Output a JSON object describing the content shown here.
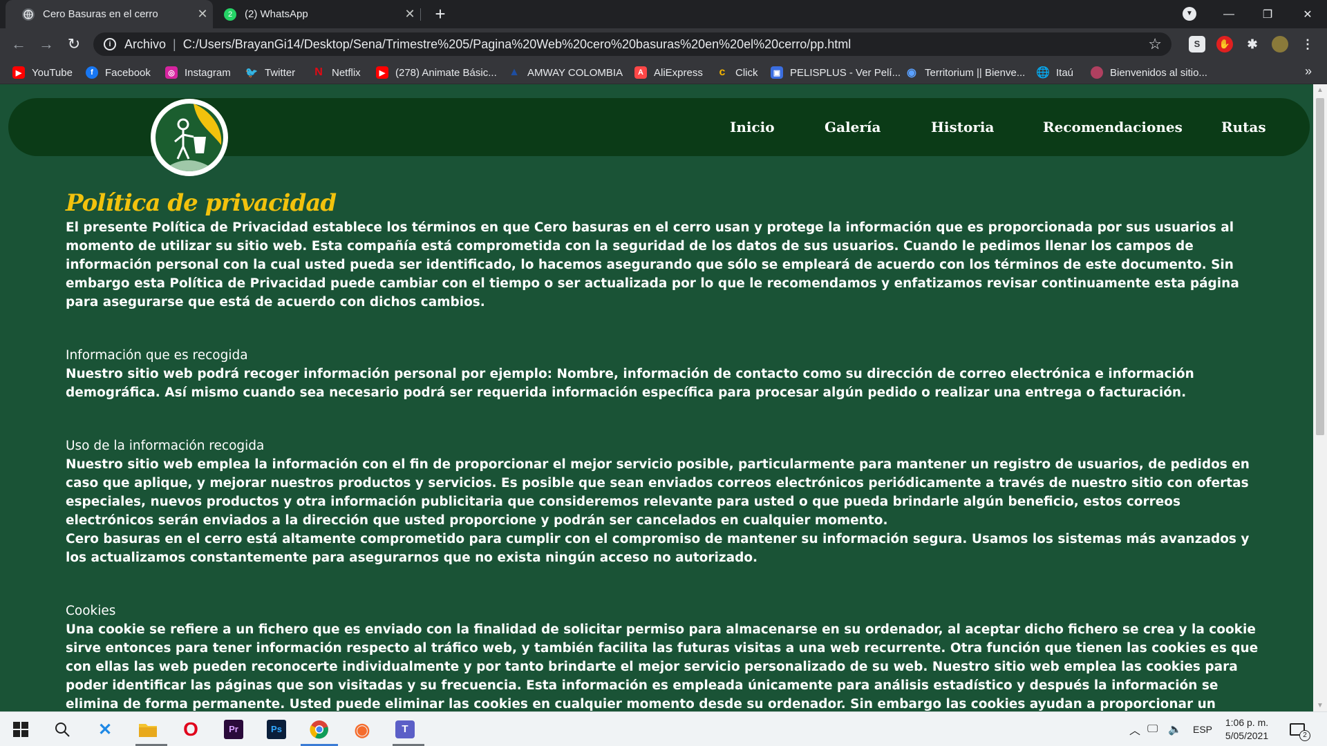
{
  "tabs": [
    {
      "title": "Cero Basuras en el cerro",
      "icon": "globe-icon"
    },
    {
      "title": "(2) WhatsApp",
      "icon": "whatsapp-icon"
    }
  ],
  "address": {
    "protocol": "Archivo",
    "url": "C:/Users/BrayanGi14/Desktop/Sena/Trimestre%205/Pagina%20Web%20cero%20basuras%20en%20el%20cerro/pp.html"
  },
  "bookmarks": [
    {
      "label": "YouTube",
      "icon": "youtube-icon",
      "color": "#ff0000"
    },
    {
      "label": "Facebook",
      "icon": "facebook-icon",
      "color": "#1877f2"
    },
    {
      "label": "Instagram",
      "icon": "instagram-icon",
      "color": "#d6249f"
    },
    {
      "label": "Twitter",
      "icon": "twitter-icon",
      "color": "#1da1f2"
    },
    {
      "label": "Netflix",
      "icon": "netflix-icon",
      "color": "#e50914"
    },
    {
      "label": "(278) Animate Básic...",
      "icon": "youtube-icon",
      "color": "#ff0000"
    },
    {
      "label": "AMWAY COLOMBIA",
      "icon": "amway-icon",
      "color": "#1e4ea1"
    },
    {
      "label": "AliExpress",
      "icon": "aliexpress-icon",
      "color": "#ff4747"
    },
    {
      "label": "Click",
      "icon": "click-icon",
      "color": "#f4b400"
    },
    {
      "label": "PELISPLUS - Ver Pelí...",
      "icon": "pelisplus-icon",
      "color": "#3b6ee0"
    },
    {
      "label": "Territorium || Bienve...",
      "icon": "territorium-icon",
      "color": "#5aa0ff"
    },
    {
      "label": "Itaú",
      "icon": "globe-icon",
      "color": "#e8eaed"
    },
    {
      "label": "Bienvenidos al sitio...",
      "icon": "site-icon",
      "color": "#b04060"
    }
  ],
  "site": {
    "nav": [
      "Inicio",
      "Galería",
      "Historia",
      "Recomendaciones",
      "Rutas"
    ],
    "title": "Política de privacidad",
    "intro": "El presente Política de Privacidad establece los términos en que Cero basuras en el cerro usan y protege la información que es proporcionada por sus usuarios al momento de utilizar su sitio web. Esta compañía está comprometida con la seguridad de los datos de sus usuarios. Cuando le pedimos llenar los campos de información personal con la cual usted pueda ser identificado, lo hacemos asegurando que sólo se empleará de acuerdo con los términos de este documento. Sin embargo esta Política de Privacidad puede cambiar con el tiempo o ser actualizada por lo que le recomendamos y enfatizamos revisar continuamente esta página para asegurarse que está de acuerdo con dichos cambios.",
    "sections": [
      {
        "title": "Información que es recogida",
        "body": "Nuestro sitio web podrá recoger información personal por ejemplo: Nombre, información de contacto como su dirección de correo electrónica e información demográfica. Así mismo cuando sea necesario podrá ser requerida información específica para procesar algún pedido o realizar una entrega o facturación."
      },
      {
        "title": "Uso de la información recogida",
        "body": "Nuestro sitio web emplea la información con el fin de proporcionar el mejor servicio posible, particularmente para mantener un registro de usuarios, de pedidos en caso que aplique, y mejorar nuestros productos y servicios. Es posible que sean enviados correos electrónicos periódicamente a través de nuestro sitio con ofertas especiales, nuevos productos y otra información publicitaria que consideremos relevante para usted o que pueda brindarle algún beneficio, estos correos electrónicos serán enviados a la dirección que usted proporcione y podrán ser cancelados en cualquier momento.",
        "body2": "Cero basuras en el cerro está altamente comprometido para cumplir con el compromiso de mantener su información segura. Usamos los sistemas más avanzados y los actualizamos constantemente para asegurarnos que no exista ningún acceso no autorizado."
      },
      {
        "title": "Cookies",
        "body": "Una cookie se refiere a un fichero que es enviado con la finalidad de solicitar permiso para almacenarse en su ordenador, al aceptar dicho fichero se crea y la cookie sirve entonces para tener información respecto al tráfico web, y también facilita las futuras visitas a una web recurrente. Otra función que tienen las cookies es que con ellas las web pueden reconocerte individualmente y por tanto brindarte el mejor servicio personalizado de su web. Nuestro sitio web emplea las cookies para poder identificar las páginas que son visitadas y su frecuencia. Esta información es empleada únicamente para análisis estadístico y después la información se elimina de forma permanente. Usted puede eliminar las cookies en cualquier momento desde su ordenador. Sin embargo las cookies ayudan a proporcionar un mejor servicio de los sitios web, estás no dan acceso a información de su ordenador ni de usted, a menos de que usted así lo quiera y la proporcione directamente. Usted puede aceptar o negar el uso de cookies, sin embargo la"
      }
    ]
  },
  "taskbar": {
    "apps": [
      "windows-start-icon",
      "search-icon",
      "xampp-icon",
      "file-explorer-icon",
      "opera-icon",
      "premiere-icon",
      "photoshop-icon",
      "chrome-icon",
      "origin-icon",
      "teams-icon"
    ],
    "lang": "ESP",
    "time": "1:06 p. m.",
    "date": "5/05/2021",
    "notifications": "2"
  },
  "colors": {
    "page_bg": "#1a5336",
    "nav_bg": "#0b3b17",
    "title_color": "#f2c20d",
    "chrome_dark": "#202124",
    "chrome_toolbar": "#35363a"
  }
}
